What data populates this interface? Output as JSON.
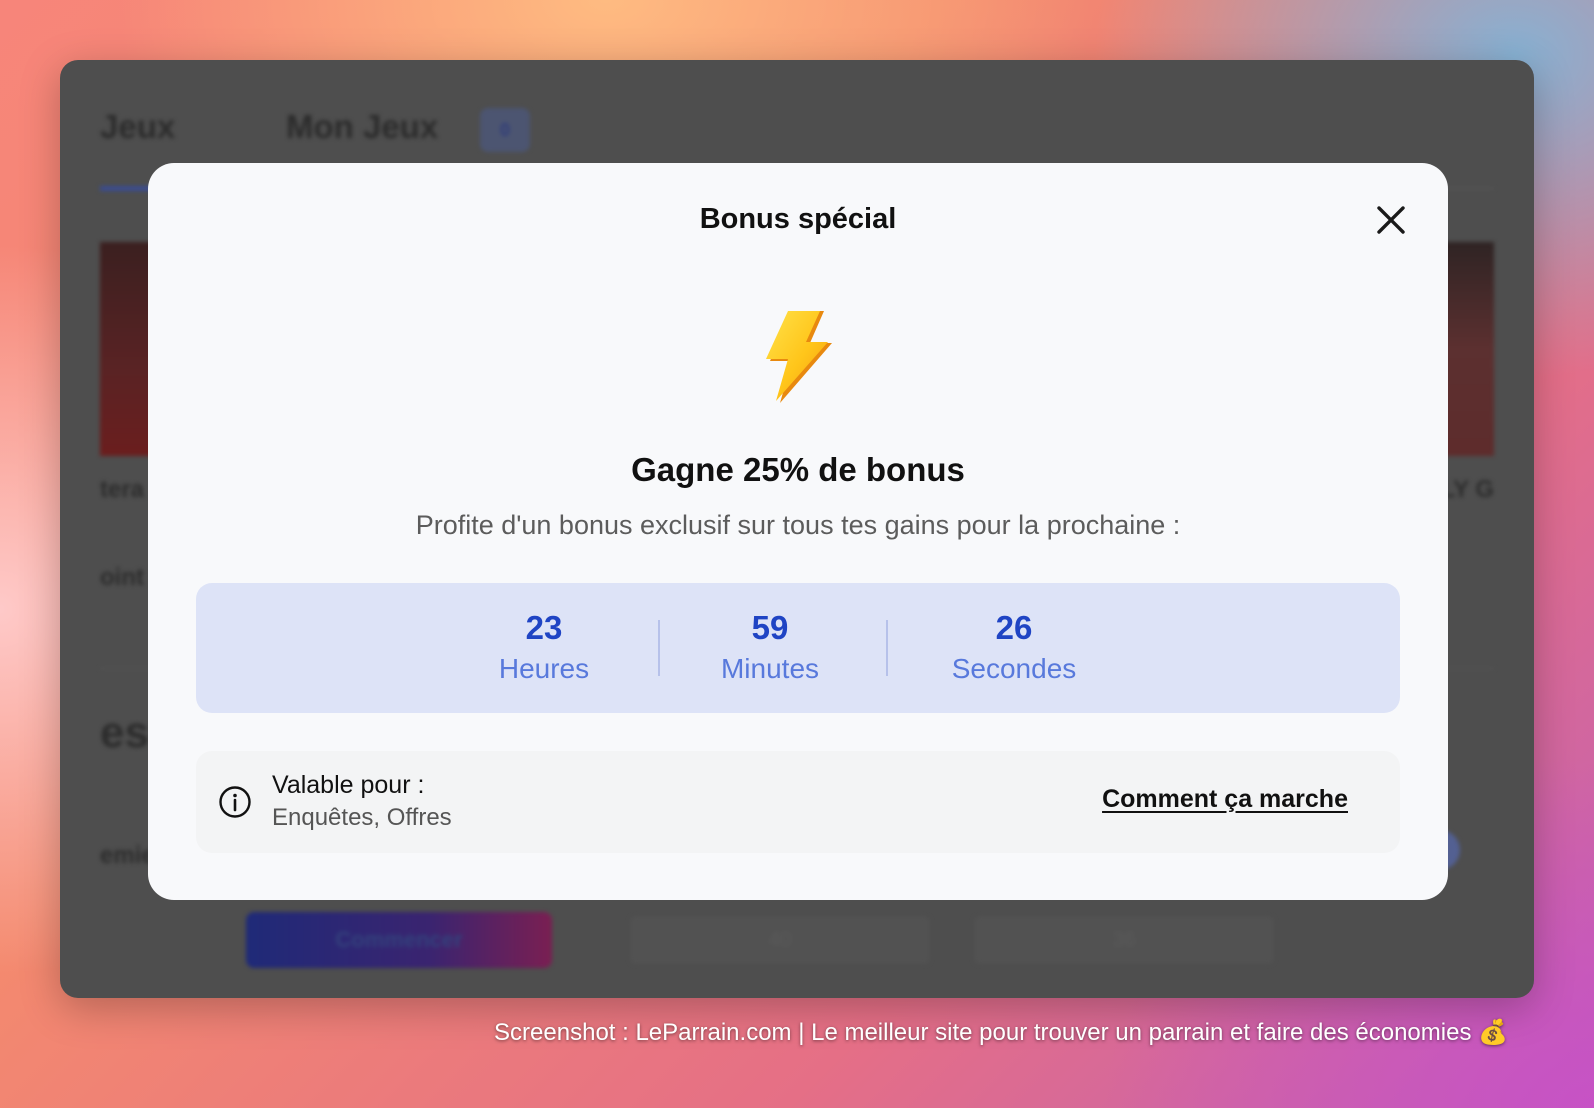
{
  "background_app": {
    "tab_games_partial": "Jeux",
    "tab_my_games": "Mon Jeux",
    "tab_badge": "0",
    "card_label_left": "tera",
    "card_label_right": "LY G",
    "row_label_left": "oint",
    "section_heading_partial": "es",
    "row2_label_left": "emie",
    "start_button": "Commencer",
    "cell_mid": "40",
    "cell_right": "36"
  },
  "modal": {
    "title": "Bonus spécial",
    "close_icon": "close-icon",
    "hero_icon": "lightning-bolt-icon",
    "headline": "Gagne 25% de bonus",
    "subtitle": "Profite d'un bonus exclusif sur tous tes gains pour la prochaine :",
    "timer": {
      "hours_value": "23",
      "hours_label": "Heures",
      "minutes_value": "59",
      "minutes_label": "Minutes",
      "seconds_value": "26",
      "seconds_label": "Secondes"
    },
    "info": {
      "icon": "info-icon",
      "title": "Valable pour :",
      "values": "Enquêtes, Offres",
      "link": "Comment ça marche"
    }
  },
  "caption": "Screenshot : LeParrain.com | Le meilleur site pour trouver un parrain et faire des économies 💰",
  "colors": {
    "accent_blue": "#1f44c4",
    "timer_bg": "#dde3f7",
    "modal_bg": "#f8f9fb",
    "window_bg": "#4e4e4e"
  }
}
